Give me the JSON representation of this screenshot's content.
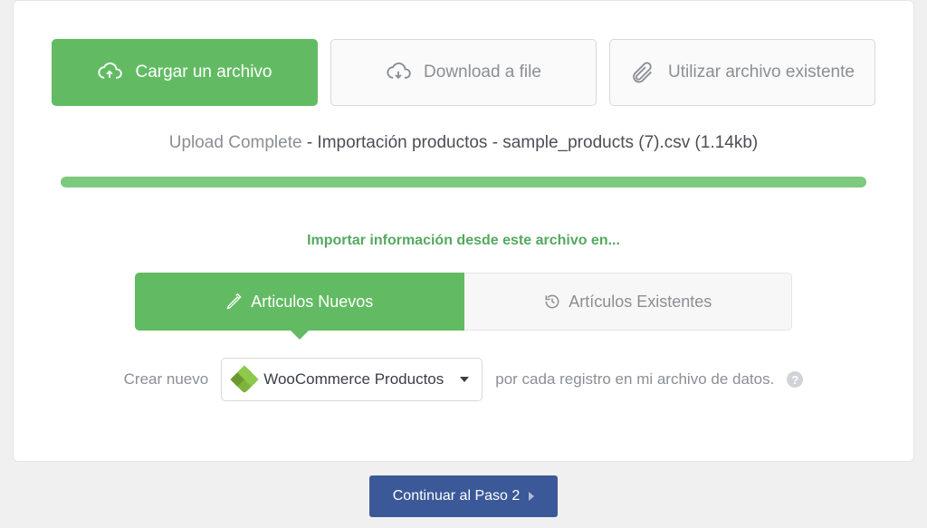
{
  "tabs": {
    "upload": "Cargar un archivo",
    "download": "Download a file",
    "existing": "Utilizar archivo existente"
  },
  "status": {
    "prefix": "Upload Complete",
    "detail": " - Importación productos - sample_products (7).csv (1.14kb)"
  },
  "import_title": "Importar información desde este archivo en...",
  "sub_tabs": {
    "new": "Articulos Nuevos",
    "existing": "Artículos Existentes"
  },
  "create": {
    "prefix": "Crear nuevo",
    "select_value": "WooCommerce Productos",
    "suffix": "por cada registro en mi archivo de datos."
  },
  "continue": "Continuar al Paso 2"
}
